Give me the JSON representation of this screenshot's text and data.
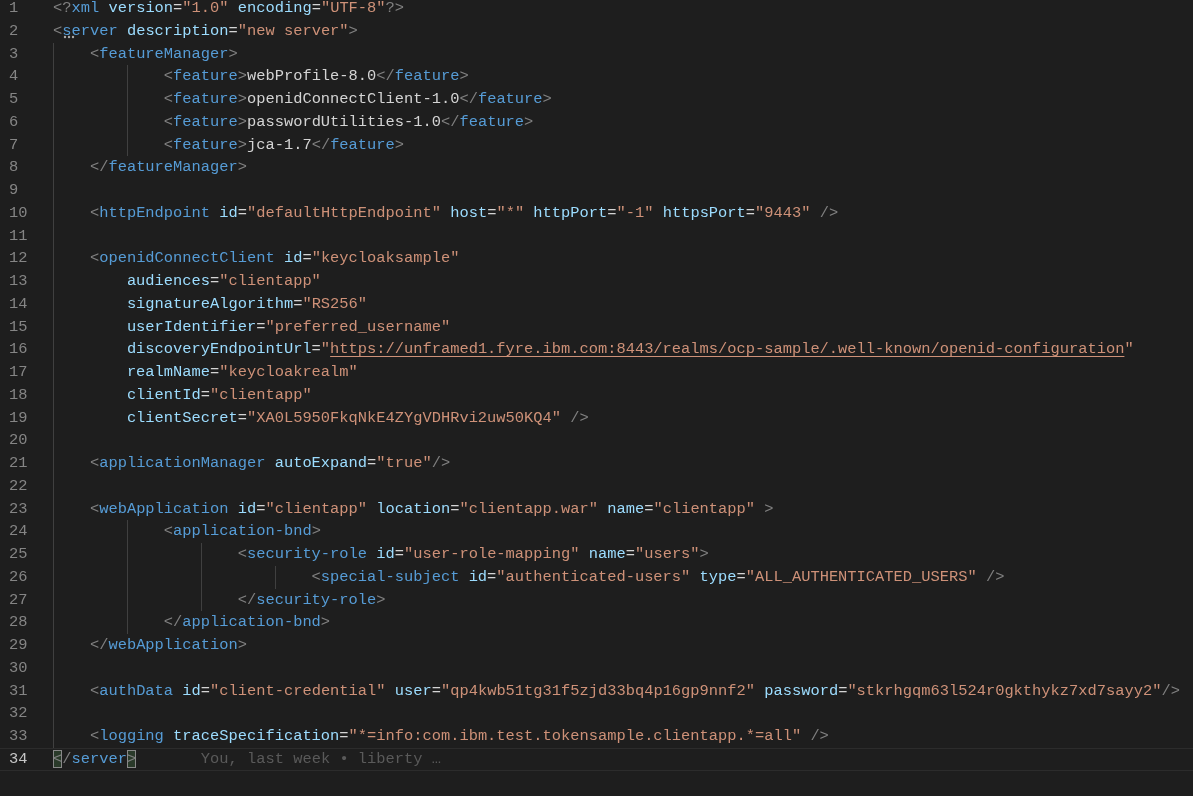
{
  "editor": {
    "lines": [
      {
        "number": "1",
        "current": false,
        "tokens": [
          {
            "kind": "punct",
            "text": "<?"
          },
          {
            "kind": "tag",
            "text": "xml "
          },
          {
            "kind": "attr",
            "text": "version"
          },
          {
            "kind": "text",
            "text": "="
          },
          {
            "kind": "string",
            "text": "\"1.0\" "
          },
          {
            "kind": "attr",
            "text": "encoding"
          },
          {
            "kind": "text",
            "text": "="
          },
          {
            "kind": "string",
            "text": "\"UTF-8\""
          },
          {
            "kind": "punct",
            "text": "?>"
          }
        ]
      },
      {
        "number": "2",
        "current": false,
        "hint": true,
        "tokens": [
          {
            "kind": "punct",
            "text": "<"
          },
          {
            "kind": "tag",
            "text": "server "
          },
          {
            "kind": "attr",
            "text": "description"
          },
          {
            "kind": "text",
            "text": "="
          },
          {
            "kind": "string",
            "text": "\"new server\""
          },
          {
            "kind": "punct",
            "text": ">"
          }
        ]
      },
      {
        "number": "3",
        "current": false,
        "tokens": [
          {
            "kind": "punct",
            "text": "    <"
          },
          {
            "kind": "tag",
            "text": "featureManager"
          },
          {
            "kind": "punct",
            "text": ">"
          }
        ]
      },
      {
        "number": "4",
        "current": false,
        "tokens": [
          {
            "kind": "punct",
            "text": "            <"
          },
          {
            "kind": "tag",
            "text": "feature"
          },
          {
            "kind": "punct",
            "text": ">"
          },
          {
            "kind": "text",
            "text": "webProfile-8.0"
          },
          {
            "kind": "punct",
            "text": "</"
          },
          {
            "kind": "tag",
            "text": "feature"
          },
          {
            "kind": "punct",
            "text": ">"
          }
        ]
      },
      {
        "number": "5",
        "current": false,
        "tokens": [
          {
            "kind": "punct",
            "text": "            <"
          },
          {
            "kind": "tag",
            "text": "feature"
          },
          {
            "kind": "punct",
            "text": ">"
          },
          {
            "kind": "text",
            "text": "openidConnectClient-1.0"
          },
          {
            "kind": "punct",
            "text": "</"
          },
          {
            "kind": "tag",
            "text": "feature"
          },
          {
            "kind": "punct",
            "text": ">"
          }
        ]
      },
      {
        "number": "6",
        "current": false,
        "tokens": [
          {
            "kind": "punct",
            "text": "            <"
          },
          {
            "kind": "tag",
            "text": "feature"
          },
          {
            "kind": "punct",
            "text": ">"
          },
          {
            "kind": "text",
            "text": "passwordUtilities-1.0"
          },
          {
            "kind": "punct",
            "text": "</"
          },
          {
            "kind": "tag",
            "text": "feature"
          },
          {
            "kind": "punct",
            "text": ">"
          }
        ]
      },
      {
        "number": "7",
        "current": false,
        "tokens": [
          {
            "kind": "punct",
            "text": "            <"
          },
          {
            "kind": "tag",
            "text": "feature"
          },
          {
            "kind": "punct",
            "text": ">"
          },
          {
            "kind": "text",
            "text": "jca-1.7"
          },
          {
            "kind": "punct",
            "text": "</"
          },
          {
            "kind": "tag",
            "text": "feature"
          },
          {
            "kind": "punct",
            "text": ">"
          }
        ]
      },
      {
        "number": "8",
        "current": false,
        "tokens": [
          {
            "kind": "punct",
            "text": "    </"
          },
          {
            "kind": "tag",
            "text": "featureManager"
          },
          {
            "kind": "punct",
            "text": ">"
          }
        ]
      },
      {
        "number": "9",
        "current": false
      },
      {
        "number": "10",
        "current": false,
        "tokens": [
          {
            "kind": "punct",
            "text": "    <"
          },
          {
            "kind": "tag",
            "text": "httpEndpoint "
          },
          {
            "kind": "attr",
            "text": "id"
          },
          {
            "kind": "text",
            "text": "="
          },
          {
            "kind": "string",
            "text": "\"defaultHttpEndpoint\" "
          },
          {
            "kind": "attr",
            "text": "host"
          },
          {
            "kind": "text",
            "text": "="
          },
          {
            "kind": "string",
            "text": "\"*\" "
          },
          {
            "kind": "attr",
            "text": "httpPort"
          },
          {
            "kind": "text",
            "text": "="
          },
          {
            "kind": "string",
            "text": "\"-1\" "
          },
          {
            "kind": "attr",
            "text": "httpsPort"
          },
          {
            "kind": "text",
            "text": "="
          },
          {
            "kind": "string",
            "text": "\"9443\" "
          },
          {
            "kind": "punct",
            "text": "/>"
          }
        ]
      },
      {
        "number": "11",
        "current": false
      },
      {
        "number": "12",
        "current": false,
        "tokens": [
          {
            "kind": "punct",
            "text": "    <"
          },
          {
            "kind": "tag",
            "text": "openidConnectClient "
          },
          {
            "kind": "attr",
            "text": "id"
          },
          {
            "kind": "text",
            "text": "="
          },
          {
            "kind": "string",
            "text": "\"keycloaksample\""
          }
        ]
      },
      {
        "number": "13",
        "current": false,
        "tokens": [
          {
            "kind": "attr",
            "text": "        audiences"
          },
          {
            "kind": "text",
            "text": "="
          },
          {
            "kind": "string",
            "text": "\"clientapp\""
          }
        ]
      },
      {
        "number": "14",
        "current": false,
        "tokens": [
          {
            "kind": "attr",
            "text": "        signatureAlgorithm"
          },
          {
            "kind": "text",
            "text": "="
          },
          {
            "kind": "string",
            "text": "\"RS256\""
          }
        ]
      },
      {
        "number": "15",
        "current": false,
        "tokens": [
          {
            "kind": "attr",
            "text": "        userIdentifier"
          },
          {
            "kind": "text",
            "text": "="
          },
          {
            "kind": "string",
            "text": "\"preferred_username\""
          }
        ]
      },
      {
        "number": "16",
        "current": false,
        "tokens": [
          {
            "kind": "attr",
            "text": "        discoveryEndpointUrl"
          },
          {
            "kind": "text",
            "text": "="
          },
          {
            "kind": "string",
            "text": "\""
          },
          {
            "kind": "link",
            "text": "https://unframed1.fyre.ibm.com:8443/realms/ocp-sample/.well-known/openid-configuration"
          },
          {
            "kind": "string",
            "text": "\""
          }
        ]
      },
      {
        "number": "17",
        "current": false,
        "tokens": [
          {
            "kind": "attr",
            "text": "        realmName"
          },
          {
            "kind": "text",
            "text": "="
          },
          {
            "kind": "string",
            "text": "\"keycloakrealm\""
          }
        ]
      },
      {
        "number": "18",
        "current": false,
        "tokens": [
          {
            "kind": "attr",
            "text": "        clientId"
          },
          {
            "kind": "text",
            "text": "="
          },
          {
            "kind": "string",
            "text": "\"clientapp\""
          }
        ]
      },
      {
        "number": "19",
        "current": false,
        "tokens": [
          {
            "kind": "attr",
            "text": "        clientSecret"
          },
          {
            "kind": "text",
            "text": "="
          },
          {
            "kind": "string",
            "text": "\"XA0L5950FkqNkE4ZYgVDHRvi2uw50KQ4\" "
          },
          {
            "kind": "punct",
            "text": "/>"
          }
        ]
      },
      {
        "number": "20",
        "current": false
      },
      {
        "number": "21",
        "current": false,
        "tokens": [
          {
            "kind": "punct",
            "text": "    <"
          },
          {
            "kind": "tag",
            "text": "applicationManager "
          },
          {
            "kind": "attr",
            "text": "autoExpand"
          },
          {
            "kind": "text",
            "text": "="
          },
          {
            "kind": "string",
            "text": "\"true\""
          },
          {
            "kind": "punct",
            "text": "/>"
          }
        ]
      },
      {
        "number": "22",
        "current": false
      },
      {
        "number": "23",
        "current": false,
        "tokens": [
          {
            "kind": "punct",
            "text": "    <"
          },
          {
            "kind": "tag",
            "text": "webApplication "
          },
          {
            "kind": "attr",
            "text": "id"
          },
          {
            "kind": "text",
            "text": "="
          },
          {
            "kind": "string",
            "text": "\"clientapp\" "
          },
          {
            "kind": "attr",
            "text": "location"
          },
          {
            "kind": "text",
            "text": "="
          },
          {
            "kind": "string",
            "text": "\"clientapp.war\" "
          },
          {
            "kind": "attr",
            "text": "name"
          },
          {
            "kind": "text",
            "text": "="
          },
          {
            "kind": "string",
            "text": "\"clientapp\""
          },
          {
            "kind": "punct",
            "text": " >"
          }
        ]
      },
      {
        "number": "24",
        "current": false,
        "tokens": [
          {
            "kind": "punct",
            "text": "            <"
          },
          {
            "kind": "tag",
            "text": "application-bnd"
          },
          {
            "kind": "punct",
            "text": ">"
          }
        ]
      },
      {
        "number": "25",
        "current": false,
        "tokens": [
          {
            "kind": "punct",
            "text": "                    <"
          },
          {
            "kind": "tag",
            "text": "security-role "
          },
          {
            "kind": "attr",
            "text": "id"
          },
          {
            "kind": "text",
            "text": "="
          },
          {
            "kind": "string",
            "text": "\"user-role-mapping\" "
          },
          {
            "kind": "attr",
            "text": "name"
          },
          {
            "kind": "text",
            "text": "="
          },
          {
            "kind": "string",
            "text": "\"users\""
          },
          {
            "kind": "punct",
            "text": ">"
          }
        ]
      },
      {
        "number": "26",
        "current": false,
        "tokens": [
          {
            "kind": "punct",
            "text": "                            <"
          },
          {
            "kind": "tag",
            "text": "special-subject "
          },
          {
            "kind": "attr",
            "text": "id"
          },
          {
            "kind": "text",
            "text": "="
          },
          {
            "kind": "string",
            "text": "\"authenticated-users\" "
          },
          {
            "kind": "attr",
            "text": "type"
          },
          {
            "kind": "text",
            "text": "="
          },
          {
            "kind": "string",
            "text": "\"ALL_AUTHENTICATED_USERS\""
          },
          {
            "kind": "punct",
            "text": " />"
          }
        ]
      },
      {
        "number": "27",
        "current": false,
        "tokens": [
          {
            "kind": "punct",
            "text": "                    </"
          },
          {
            "kind": "tag",
            "text": "security-role"
          },
          {
            "kind": "punct",
            "text": ">"
          }
        ]
      },
      {
        "number": "28",
        "current": false,
        "tokens": [
          {
            "kind": "punct",
            "text": "            </"
          },
          {
            "kind": "tag",
            "text": "application-bnd"
          },
          {
            "kind": "punct",
            "text": ">"
          }
        ]
      },
      {
        "number": "29",
        "current": false,
        "tokens": [
          {
            "kind": "punct",
            "text": "    </"
          },
          {
            "kind": "tag",
            "text": "webApplication"
          },
          {
            "kind": "punct",
            "text": ">"
          }
        ]
      },
      {
        "number": "30",
        "current": false
      },
      {
        "number": "31",
        "current": false,
        "tokens": [
          {
            "kind": "punct",
            "text": "    <"
          },
          {
            "kind": "tag",
            "text": "authData "
          },
          {
            "kind": "attr",
            "text": "id"
          },
          {
            "kind": "text",
            "text": "="
          },
          {
            "kind": "string",
            "text": "\"client-credential\" "
          },
          {
            "kind": "attr",
            "text": "user"
          },
          {
            "kind": "text",
            "text": "="
          },
          {
            "kind": "string",
            "text": "\"qp4kwb51tg31f5zjd33bq4p16gp9nnf2\" "
          },
          {
            "kind": "attr",
            "text": "password"
          },
          {
            "kind": "text",
            "text": "="
          },
          {
            "kind": "string",
            "text": "\"stkrhgqm63l524r0gkthykz7xd7sayy2\""
          },
          {
            "kind": "punct",
            "text": "/>"
          }
        ]
      },
      {
        "number": "32",
        "current": false
      },
      {
        "number": "33",
        "current": false,
        "tokens": [
          {
            "kind": "punct",
            "text": "    <"
          },
          {
            "kind": "tag",
            "text": "logging "
          },
          {
            "kind": "attr",
            "text": "traceSpecification"
          },
          {
            "kind": "text",
            "text": "="
          },
          {
            "kind": "string",
            "text": "\"*=info:com.ibm.test.tokensample.clientapp.*=all\""
          },
          {
            "kind": "punct",
            "text": " />"
          }
        ]
      },
      {
        "number": "34",
        "current": true,
        "blame": "You, last week • liberty …",
        "tokens": [
          {
            "kind": "match",
            "text": "<"
          },
          {
            "kind": "punct",
            "text": "/"
          },
          {
            "kind": "tag",
            "text": "server"
          },
          {
            "kind": "match",
            "text": ">"
          }
        ]
      }
    ]
  }
}
